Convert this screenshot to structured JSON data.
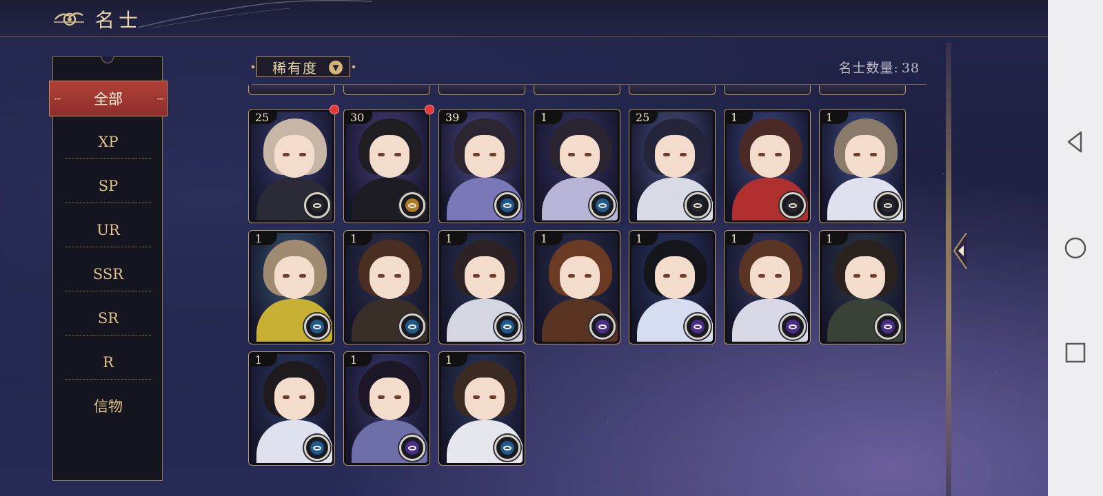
{
  "header": {
    "title": "名士"
  },
  "side_menu": {
    "items": [
      {
        "label": "全部",
        "active": true
      },
      {
        "label": "XP"
      },
      {
        "label": "SP"
      },
      {
        "label": "UR"
      },
      {
        "label": "SSR"
      },
      {
        "label": "SR"
      },
      {
        "label": "R"
      },
      {
        "label": "信物"
      }
    ]
  },
  "filter": {
    "label": "稀有度",
    "icon": "chevron-down-icon"
  },
  "count": {
    "label": "名士数量:",
    "value": "38"
  },
  "cards": [
    {
      "level": "25",
      "badge": "dark",
      "new": true,
      "palette": [
        "#c7b6a6",
        "#3a3e73",
        "#2b2b38"
      ]
    },
    {
      "level": "30",
      "badge": "gold",
      "new": true,
      "palette": [
        "#1f1c22",
        "#4a3f7d",
        "#1c1c22"
      ]
    },
    {
      "level": "39",
      "badge": "blue",
      "new": false,
      "palette": [
        "#2a2530",
        "#4f4b8a",
        "#7a78b8"
      ]
    },
    {
      "level": "1",
      "badge": "blue",
      "new": false,
      "palette": [
        "#2a2330",
        "#38366a",
        "#b8b4d6"
      ]
    },
    {
      "level": "25",
      "badge": "dark",
      "new": false,
      "palette": [
        "#24243a",
        "#4a5384",
        "#d8dae6"
      ]
    },
    {
      "level": "1",
      "badge": "dark",
      "new": false,
      "palette": [
        "#4a2a26",
        "#3e4a86",
        "#b03030"
      ]
    },
    {
      "level": "1",
      "badge": "dark",
      "new": false,
      "palette": [
        "#8a7a6a",
        "#3e4f8a",
        "#dfe2ee"
      ]
    },
    {
      "level": "1",
      "badge": "blue",
      "new": false,
      "palette": [
        "#a08a70",
        "#3a5a78",
        "#c8b035"
      ]
    },
    {
      "level": "1",
      "badge": "blue",
      "new": false,
      "palette": [
        "#4a2e22",
        "#2c3350",
        "#3a2e28"
      ]
    },
    {
      "level": "1",
      "badge": "blue",
      "new": false,
      "palette": [
        "#2c2226",
        "#2b3656",
        "#d4d6e2"
      ]
    },
    {
      "level": "1",
      "badge": "purple",
      "new": false,
      "palette": [
        "#6a3a22",
        "#2a3050",
        "#5a3422"
      ]
    },
    {
      "level": "1",
      "badge": "purple",
      "new": false,
      "palette": [
        "#15151c",
        "#2b3a66",
        "#d6dcf0"
      ]
    },
    {
      "level": "1",
      "badge": "purple",
      "new": false,
      "palette": [
        "#5a3526",
        "#343a62",
        "#d8d8e6"
      ]
    },
    {
      "level": "1",
      "badge": "purple",
      "new": false,
      "palette": [
        "#2a221e",
        "#2e3b4a",
        "#3a4238"
      ]
    },
    {
      "level": "1",
      "badge": "blue",
      "new": false,
      "palette": [
        "#1e1a1e",
        "#2e3a66",
        "#dfe2ee"
      ]
    },
    {
      "level": "1",
      "badge": "purple",
      "new": false,
      "palette": [
        "#1c1626",
        "#3a3a6e",
        "#6e6ea8"
      ]
    },
    {
      "level": "1",
      "badge": "blue",
      "new": false,
      "palette": [
        "#3a2a22",
        "#2e3a5e",
        "#e6e6ee"
      ]
    }
  ],
  "nav": {
    "back": "back-icon",
    "home": "home-icon",
    "recents": "recents-icon"
  }
}
